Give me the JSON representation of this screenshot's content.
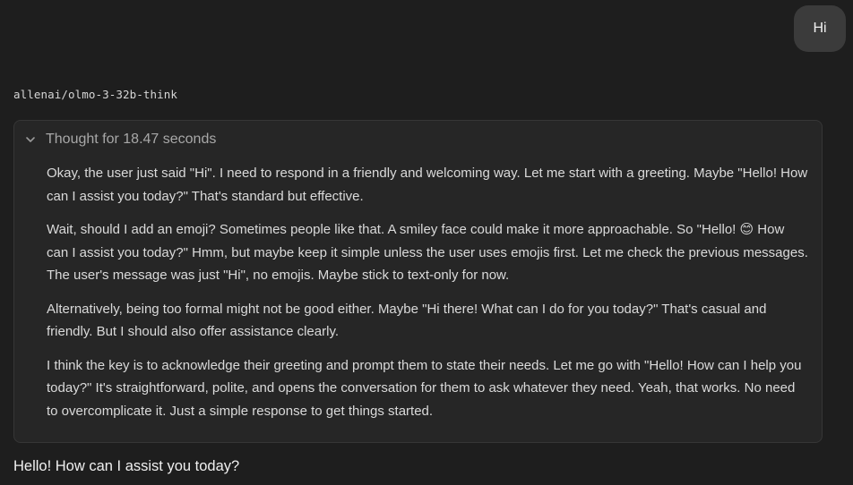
{
  "user_message": {
    "text": "Hi"
  },
  "assistant": {
    "model_name": "allenai/olmo-3-32b-think",
    "thought": {
      "header_label": "Thought for 18.47 seconds",
      "chevron_icon": "chevron-down-icon",
      "paragraphs": [
        "Okay, the user just said \"Hi\". I need to respond in a friendly and welcoming way. Let me start with a greeting. Maybe \"Hello! How can I assist you today?\" That's standard but effective.",
        "Wait, should I add an emoji? Sometimes people like that. A smiley face could make it more approachable. So \"Hello! 😊 How can I assist you today?\" Hmm, but maybe keep it simple unless the user uses emojis first. Let me check the previous messages. The user's message was just \"Hi\", no emojis. Maybe stick to text-only for now.",
        "Alternatively, being too formal might not be good either. Maybe \"Hi there! What can I do for you today?\" That's casual and friendly. But I should also offer assistance clearly.",
        "I think the key is to acknowledge their greeting and prompt them to state their needs. Let me go with \"Hello! How can I help you today?\" It's straightforward, polite, and opens the conversation for them to ask whatever they need. Yeah, that works. No need to overcomplicate it. Just a simple response to get things started."
      ]
    },
    "answer": "Hello! How can I assist you today?"
  },
  "colors": {
    "background": "#1e1e1e",
    "user_bubble": "#3b3b3b",
    "thought_card": "#262626",
    "thought_border": "#363636",
    "muted_text": "#a8a8a8",
    "body_text": "#dadada"
  }
}
